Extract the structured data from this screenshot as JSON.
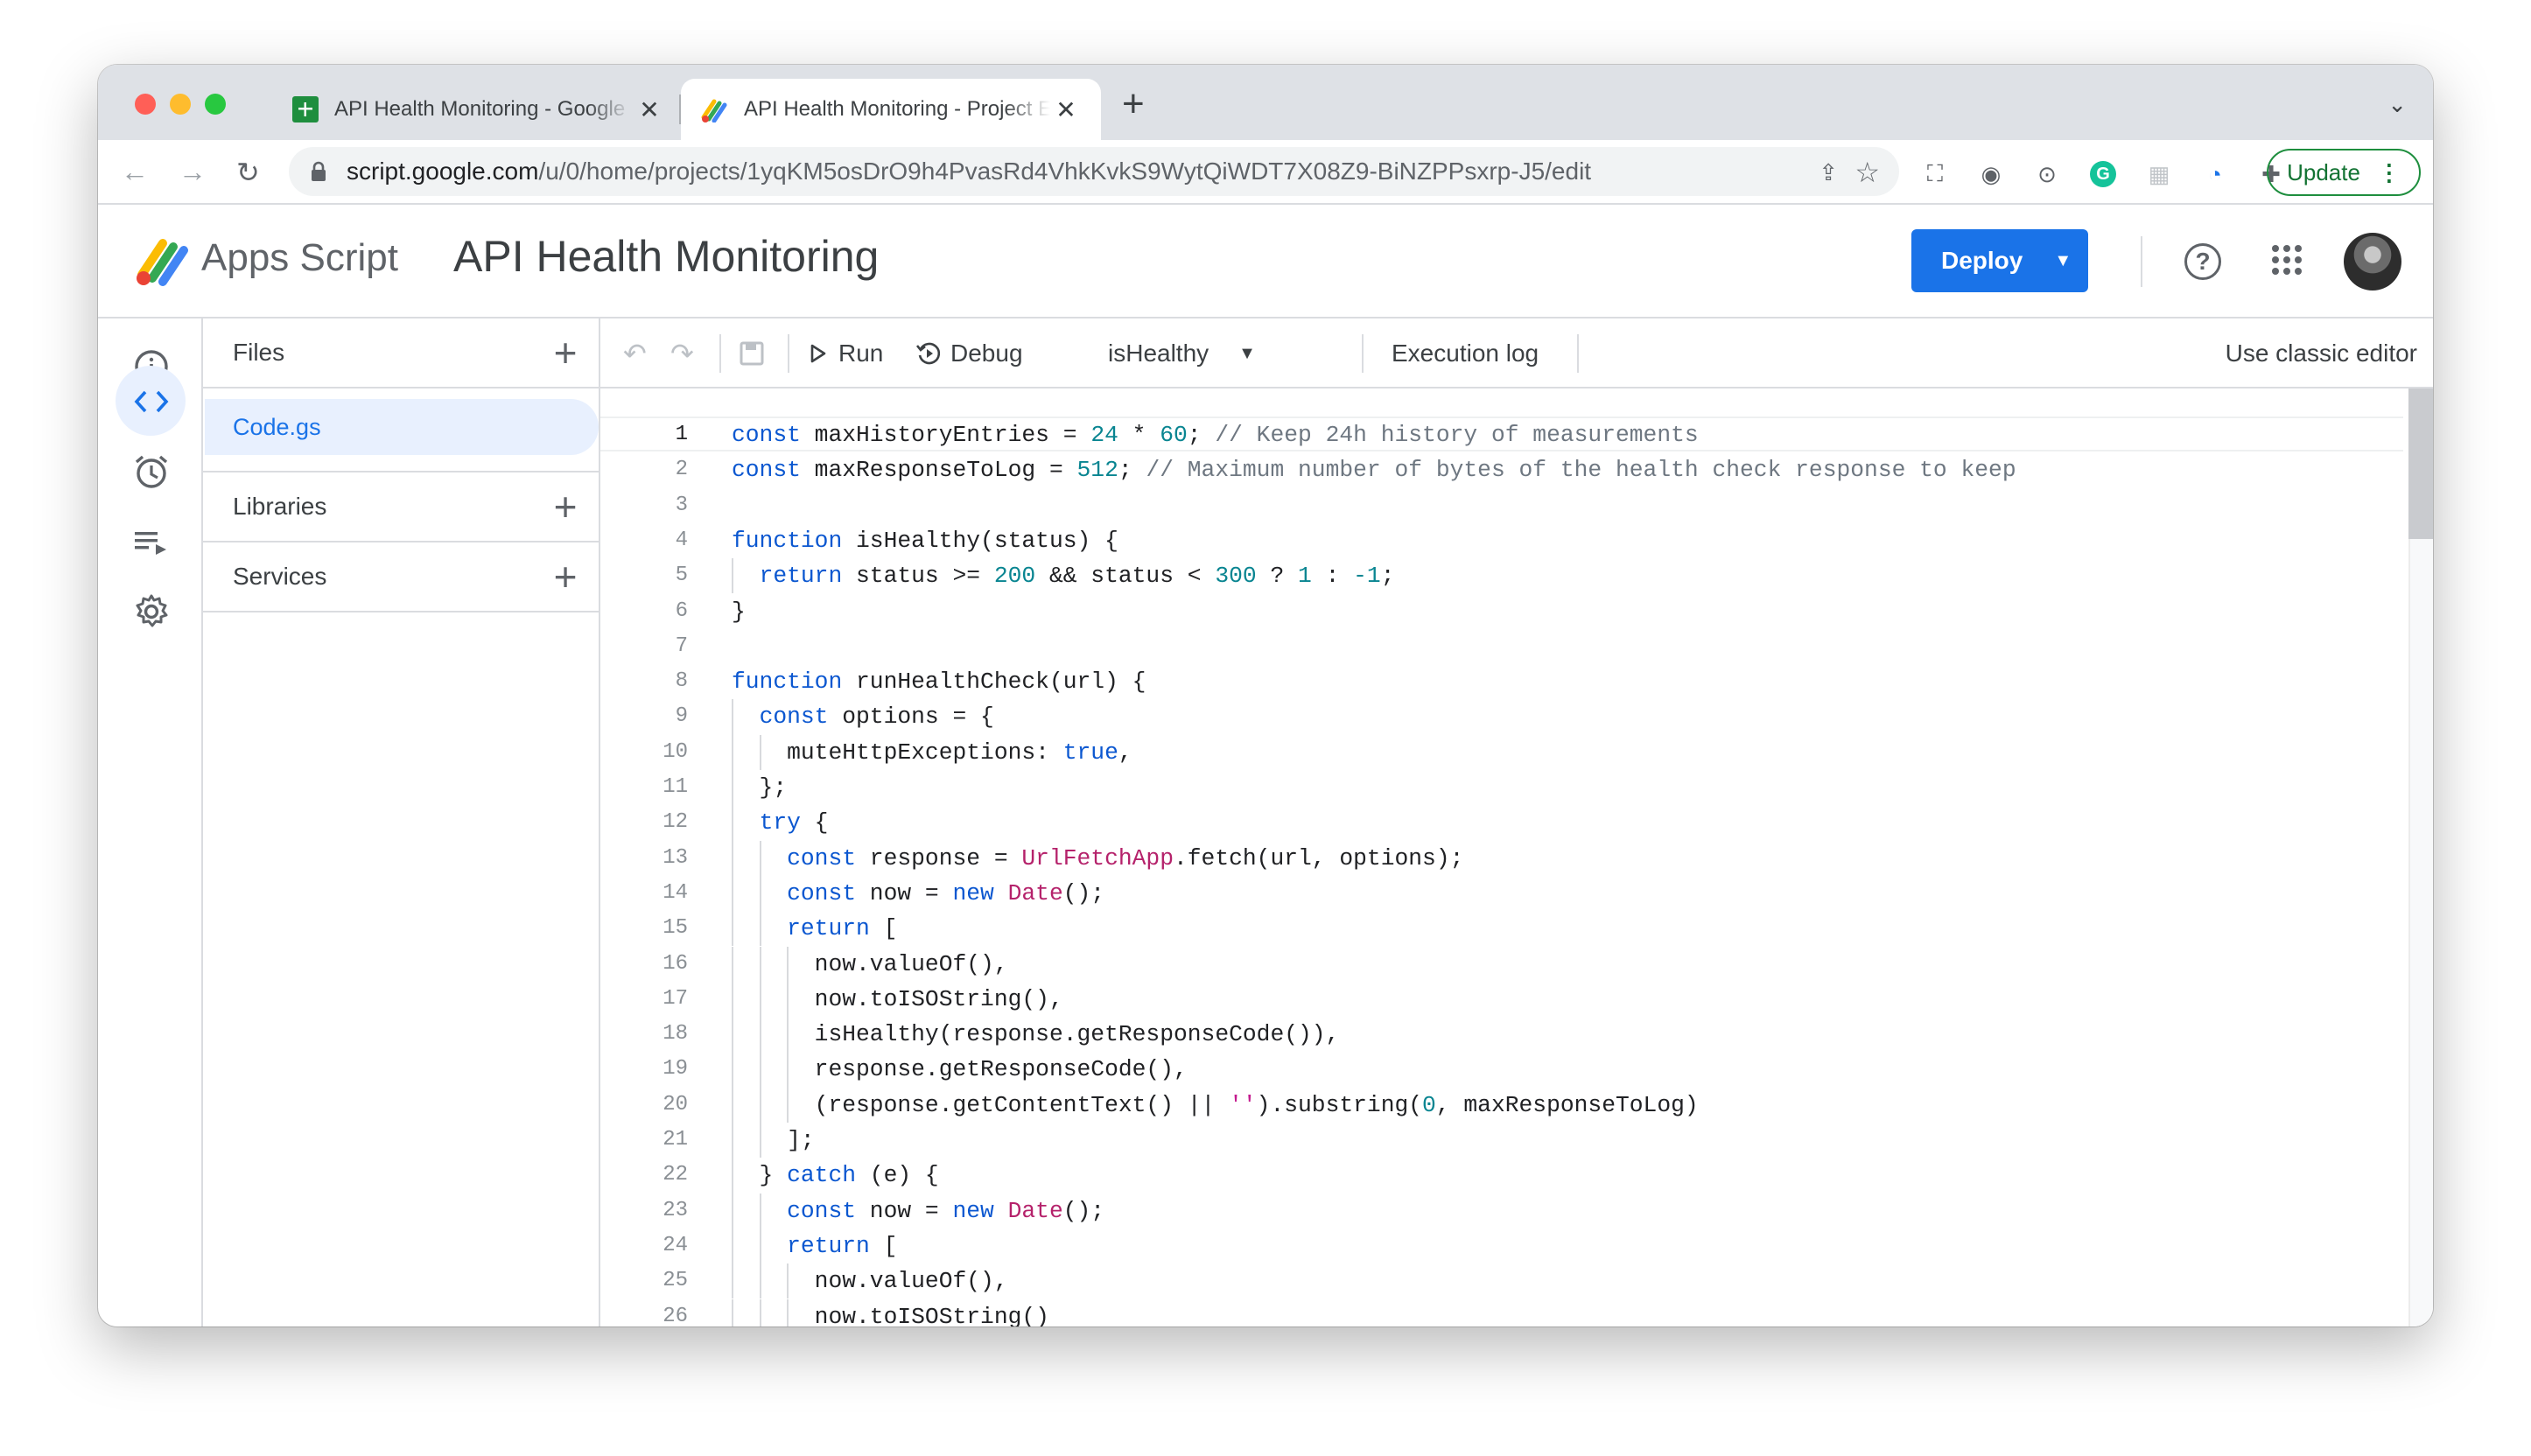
{
  "browser": {
    "tabs": [
      {
        "title": "API Health Monitoring - Google Sheets",
        "icon": "sheets-icon",
        "active": false
      },
      {
        "title": "API Health Monitoring - Project Editor",
        "icon": "apps-script-icon",
        "active": true
      }
    ],
    "url_host": "script.google.com",
    "url_path": "/u/0/home/projects/1yqKM5osDrO9h4PvasRd4VhkKvkS9WytQiWDT7X08Z9-BiNZPPsxrp-J5/edit",
    "update_label": "Update"
  },
  "app": {
    "product_name": "Apps Script",
    "project_title": "API Health Monitoring",
    "deploy_label": "Deploy"
  },
  "sidebar": {
    "files_label": "Files",
    "files": [
      "Code.gs"
    ],
    "libraries_label": "Libraries",
    "services_label": "Services"
  },
  "editor_toolbar": {
    "run_label": "Run",
    "debug_label": "Debug",
    "function_select": "isHealthy",
    "execution_log_label": "Execution log",
    "classic_editor_label": "Use classic editor"
  },
  "colors": {
    "accent": "#1a73e8",
    "keyword": "#0b57d0",
    "number": "#098591",
    "comment": "#6e7781",
    "class": "#b5226b"
  },
  "code": {
    "current_line": 1,
    "lines": [
      "const maxHistoryEntries = 24 * 60; // Keep 24h history of measurements",
      "const maxResponseToLog = 512; // Maximum number of bytes of the health check response to keep",
      "",
      "function isHealthy(status) {",
      "  return status >= 200 && status < 300 ? 1 : -1;",
      "}",
      "",
      "function runHealthCheck(url) {",
      "  const options = {",
      "    muteHttpExceptions: true,",
      "  };",
      "  try {",
      "    const response = UrlFetchApp.fetch(url, options);",
      "    const now = new Date();",
      "    return [",
      "      now.valueOf(),",
      "      now.toISOString(),",
      "      isHealthy(response.getResponseCode()),",
      "      response.getResponseCode(),",
      "      (response.getContentText() || '').substring(0, maxResponseToLog)",
      "    ];",
      "  } catch (e) {",
      "    const now = new Date();",
      "    return [",
      "      now.valueOf(),",
      "      now.toISOString()"
    ]
  }
}
